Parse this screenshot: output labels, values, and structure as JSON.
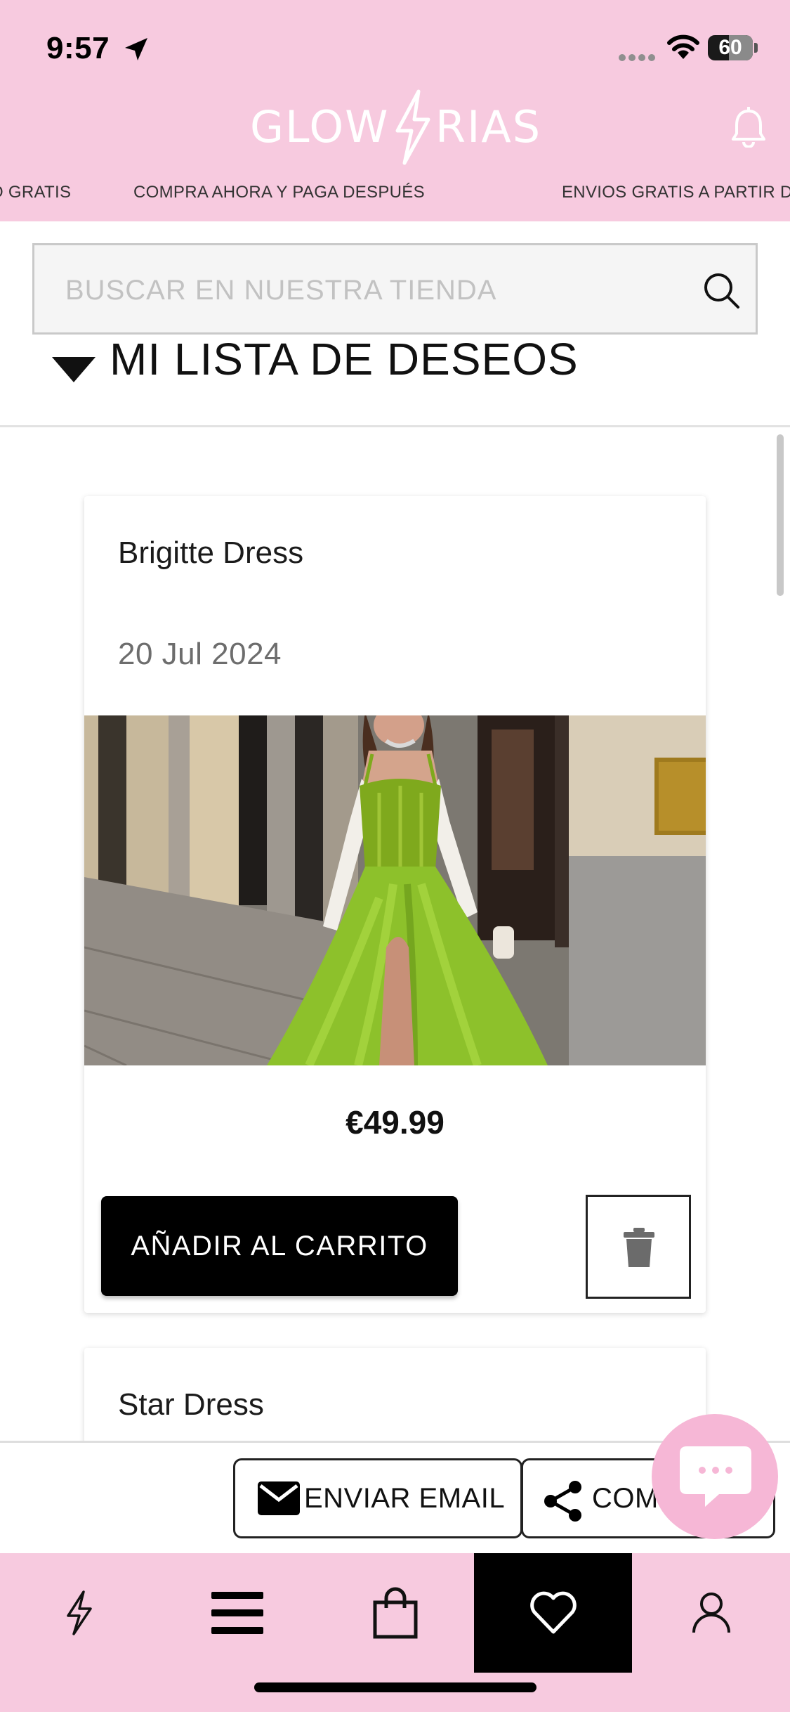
{
  "status_bar": {
    "time": "9:57",
    "battery": "60"
  },
  "header": {
    "logo_left": "GLOW",
    "logo_right": "RIAS",
    "marquee": [
      "O GRATIS",
      "COMPRA AHORA Y PAGA DESPUÉS",
      "ENVIOS GRATIS A PARTIR D"
    ]
  },
  "search": {
    "placeholder": "BUSCAR EN NUESTRA TIENDA"
  },
  "wishlist": {
    "title": "MI LISTA DE DESEOS",
    "items": [
      {
        "name": "Brigitte Dress",
        "date": "20 Jul 2024",
        "price": "€49.99",
        "add_to_cart_label": "AÑADIR AL CARRITO"
      },
      {
        "name": "Star Dress"
      }
    ]
  },
  "share_bar": {
    "email_label": "ENVIAR EMAIL",
    "share_label": "COM"
  },
  "tab_bar": {
    "items": [
      "flash-icon",
      "menu-icon",
      "bag-icon",
      "heart-icon",
      "user-icon"
    ],
    "active": "heart-icon"
  },
  "colors": {
    "header_pink": "#f7cadf",
    "chat_pink": "#f6b7d6",
    "button_black": "#000000",
    "dress_green": "#8dc12b"
  }
}
